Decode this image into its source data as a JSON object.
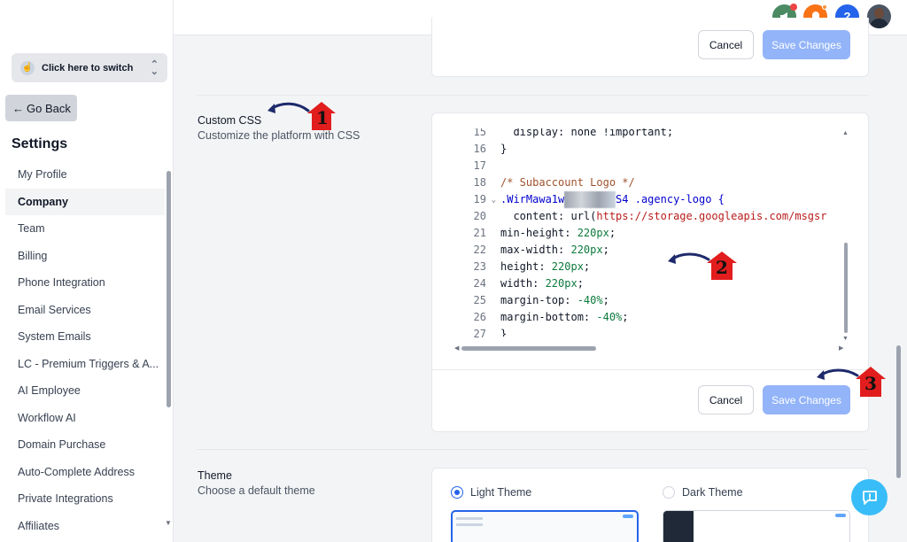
{
  "sidebar": {
    "switcher_label": "Click here to switch",
    "go_back": "Go Back",
    "settings_title": "Settings",
    "items": [
      {
        "label": "My Profile"
      },
      {
        "label": "Company"
      },
      {
        "label": "Team"
      },
      {
        "label": "Billing"
      },
      {
        "label": "Phone Integration"
      },
      {
        "label": "Email Services"
      },
      {
        "label": "System Emails"
      },
      {
        "label": "LC - Premium Triggers & A..."
      },
      {
        "label": "AI Employee"
      },
      {
        "label": "Workflow AI"
      },
      {
        "label": "Domain Purchase"
      },
      {
        "label": "Auto-Complete Address"
      },
      {
        "label": "Private Integrations"
      },
      {
        "label": "Affiliates"
      }
    ],
    "active_item": "Company"
  },
  "topbar": {
    "icons": [
      "megaphone-icon",
      "bell-icon",
      "help-icon",
      "avatar"
    ],
    "help_glyph": "?"
  },
  "top_card": {
    "cancel": "Cancel",
    "save": "Save Changes"
  },
  "custom_css": {
    "title": "Custom CSS",
    "description": "Customize the platform with CSS",
    "cancel": "Cancel",
    "save": "Save Changes",
    "lines": [
      {
        "n": "15",
        "text": "  display: none !important;"
      },
      {
        "n": "16",
        "text": "}"
      },
      {
        "n": "17",
        "text": ""
      },
      {
        "n": "18",
        "text": "/* Subaccount Logo */"
      },
      {
        "n": "19",
        "sel_start": ".WirMawa1w",
        "sel_end": "S4",
        "rest": " .agency-logo {"
      },
      {
        "n": "20",
        "prop": "  content: url(",
        "url": "https://storage.googleapis.com/msgsr"
      },
      {
        "n": "21",
        "prop": "min-height: ",
        "num": "220px",
        "end": ";"
      },
      {
        "n": "22",
        "prop": "max-width: ",
        "num": "220px",
        "end": ";"
      },
      {
        "n": "23",
        "prop": "height: ",
        "num": "220px",
        "end": ";"
      },
      {
        "n": "24",
        "prop": "width: ",
        "num": "220px",
        "end": ";"
      },
      {
        "n": "25",
        "prop": "margin-top: ",
        "num": "-40%",
        "end": ";"
      },
      {
        "n": "26",
        "prop": "margin-bottom: ",
        "num": "-40%",
        "end": ";"
      },
      {
        "n": "27",
        "text": "}"
      }
    ]
  },
  "theme": {
    "title": "Theme",
    "description": "Choose a default theme",
    "options": [
      {
        "label": "Light Theme",
        "selected": true
      },
      {
        "label": "Dark Theme",
        "selected": false
      }
    ]
  },
  "annotations": [
    "1",
    "2",
    "3"
  ],
  "colors": {
    "accent": "#2563eb",
    "save_disabled": "#93b4f8",
    "annotation_red": "#e11d1d",
    "annotation_arrow": "#1e2a6b"
  }
}
